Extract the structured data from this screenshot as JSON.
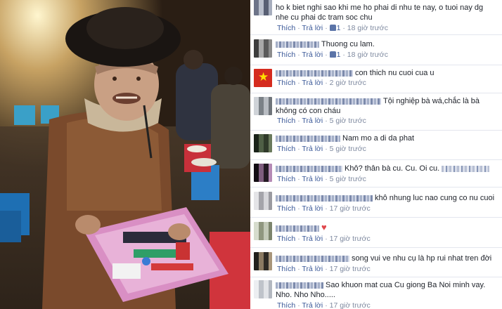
{
  "comments": [
    {
      "id": "c1",
      "text": "ho k biet nghi sao khi me ho phai di nhu te nay, o tuoi nay dg nhe cu phai dc tram soc chu",
      "reply": "Trả lời",
      "like": "Thích",
      "likes": "1",
      "time": "18 giờ trước",
      "avatar": "pixelated"
    },
    {
      "id": "c2",
      "text": "Thuong cu lam.",
      "reply": "Trả lời",
      "like": "Thích",
      "likes": "1",
      "time": "18 giờ trước",
      "avatar": "pixelated"
    },
    {
      "id": "c3",
      "text": "con thich nu cuoi cua u",
      "reply": "Trả lời",
      "like": "Thích",
      "time": "2 giờ trước",
      "avatar": "flag"
    },
    {
      "id": "c4",
      "text": "Tội nghiệp bà wá,chắc là bà không có con cháu",
      "reply": "Trả lời",
      "like": "Thích",
      "time": "5 giờ trước",
      "avatar": "pixelated"
    },
    {
      "id": "c5",
      "text": "Nam mo a di da phat",
      "reply": "Trả lời",
      "like": "Thích",
      "time": "5 giờ trước",
      "avatar": "pixelated"
    },
    {
      "id": "c6",
      "text": "Khô? thân bà cu. Cu. Oi cu.",
      "reply": "Trả lời",
      "like": "Thích",
      "time": "5 giờ trước",
      "avatar": "pixelated"
    },
    {
      "id": "c7",
      "text": "khô nhung luc nao cung co nu cuoi",
      "reply": "Trả lời",
      "like": "Thích",
      "time": "17 giờ trước",
      "avatar": "pixelated"
    },
    {
      "id": "c8",
      "text": "♥",
      "reply": "Trả lời",
      "like": "Thích",
      "time": "17 giờ trước",
      "avatar": "pixelated"
    },
    {
      "id": "c9",
      "text": "song vui ve nhu cụ là hp rui nhat tren đời",
      "reply": "Trả lời",
      "like": "Thích",
      "time": "17 giờ trước",
      "avatar": "pixelated"
    },
    {
      "id": "c10",
      "text": "Sao khuon mat cua Cu giong Ba Noi minh vay. Nho. Nho Nho.....",
      "reply": "Trả lời",
      "like": "Thích",
      "time": "17 giờ trước",
      "avatar": "pixelated"
    }
  ],
  "separator": "·",
  "colors": {
    "link": "#3b5998",
    "meta": "#7f8aa0",
    "text": "#1d2129",
    "border": "#e3e6ee"
  }
}
